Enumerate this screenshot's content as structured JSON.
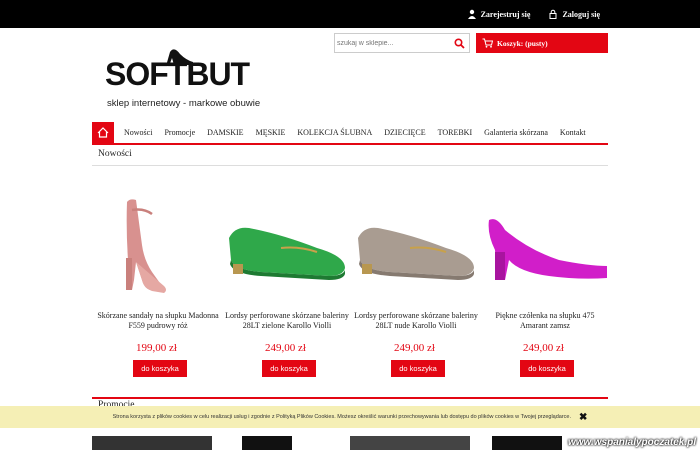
{
  "topbar": {
    "register_label": "Zarejestruj się",
    "login_label": "Zaloguj się"
  },
  "logo": {
    "brand": "SOFTBUT",
    "tagline": "sklep internetowy - markowe obuwie"
  },
  "search": {
    "placeholder": "szukaj w sklepie..."
  },
  "cart": {
    "label": "Koszyk: (pusty)"
  },
  "nav": {
    "items": [
      "Nowości",
      "Promocje",
      "DAMSKIE",
      "MĘSKIE",
      "KOLEKCJA ŚLUBNA",
      "DZIECIĘCE",
      "TOREBKI",
      "Galanteria skórzana",
      "Kontakt"
    ]
  },
  "sections": {
    "new_title": "Nowości",
    "promo_title": "Promocje"
  },
  "products": [
    {
      "name": "Skórzane sandały na słupku Madonna F559 pudrowy róż",
      "price": "199,00 zł",
      "button": "do koszyka"
    },
    {
      "name": "Lordsy perforowane skórzane baleriny 28LT zielone Karollo Violli",
      "price": "249,00 zł",
      "button": "do koszyka"
    },
    {
      "name": "Lordsy perforowane skórzane baleriny 28LT nude Karollo Violli",
      "price": "249,00 zł",
      "button": "do koszyka"
    },
    {
      "name": "Piękne czółenka na słupku 475 Amarant zamsz",
      "price": "249,00 zł",
      "button": "do koszyka"
    }
  ],
  "cookie": {
    "text": "Strona korzysta z plików cookies w celu realizacji usług i zgodnie z Polityką Plików Cookies. Możesz określić warunki przechowywania lub dostępu do plików cookies w Twojej przeglądarce."
  },
  "watermark": "www.wspanialypoczatek.pl",
  "colors": {
    "accent": "#e30613",
    "cookie_bg": "#f5efb5"
  }
}
